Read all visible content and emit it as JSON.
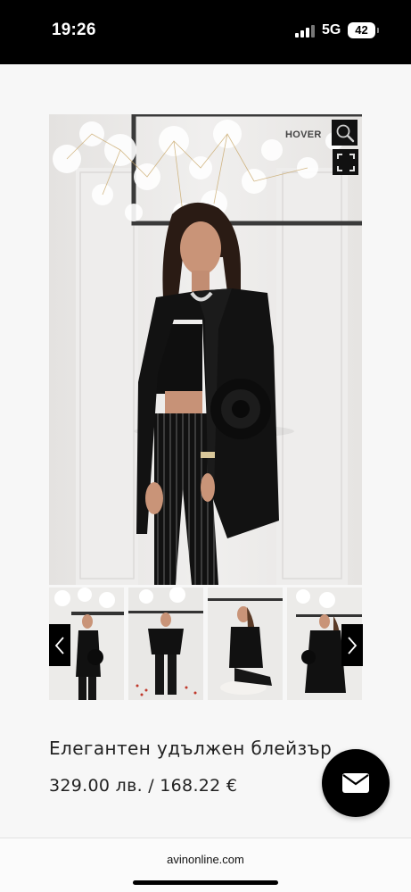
{
  "status_bar": {
    "time": "19:26",
    "network": "5G",
    "battery": "42"
  },
  "gallery": {
    "hover_label": "HOVER",
    "zoom_icon": "magnifier-icon",
    "expand_icon": "expand-icon",
    "thumbnail_count": 4
  },
  "product": {
    "title": "Елегантен удължен блейзър",
    "price": "329.00 лв. / 168.22 €"
  },
  "browser": {
    "url": "avinonline.com"
  },
  "colors": {
    "background": "#f7f7f7",
    "status_bar": "#000000",
    "buttons": "#111111"
  }
}
